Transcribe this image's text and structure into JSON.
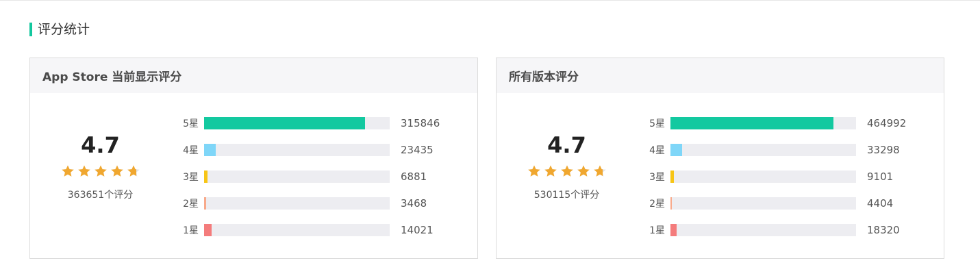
{
  "section": {
    "title": "评分统计"
  },
  "cards": [
    {
      "title": "App Store 当前显示评分",
      "score": "4.7",
      "rating": 4.7,
      "count_text": "363651个评分",
      "rows": [
        {
          "label": "5星",
          "value": "315846",
          "fraction": 0.868,
          "color": "#13c9a0"
        },
        {
          "label": "4星",
          "value": "23435",
          "fraction": 0.064,
          "color": "#7fd6f8"
        },
        {
          "label": "3星",
          "value": "6881",
          "fraction": 0.019,
          "color": "#f7c516"
        },
        {
          "label": "2星",
          "value": "3468",
          "fraction": 0.01,
          "color": "#f8a98a"
        },
        {
          "label": "1星",
          "value": "14021",
          "fraction": 0.039,
          "color": "#f47c7c"
        }
      ]
    },
    {
      "title": "所有版本评分",
      "score": "4.7",
      "rating": 4.7,
      "count_text": "530115个评分",
      "rows": [
        {
          "label": "5星",
          "value": "464992",
          "fraction": 0.877,
          "color": "#13c9a0"
        },
        {
          "label": "4星",
          "value": "33298",
          "fraction": 0.063,
          "color": "#7fd6f8"
        },
        {
          "label": "3星",
          "value": "9101",
          "fraction": 0.017,
          "color": "#f7c516"
        },
        {
          "label": "2星",
          "value": "4404",
          "fraction": 0.008,
          "color": "#f8a98a"
        },
        {
          "label": "1星",
          "value": "18320",
          "fraction": 0.035,
          "color": "#f47c7c"
        }
      ]
    }
  ],
  "star_colors": {
    "filled": "#f0a72f",
    "empty": "#e3e3e3"
  }
}
